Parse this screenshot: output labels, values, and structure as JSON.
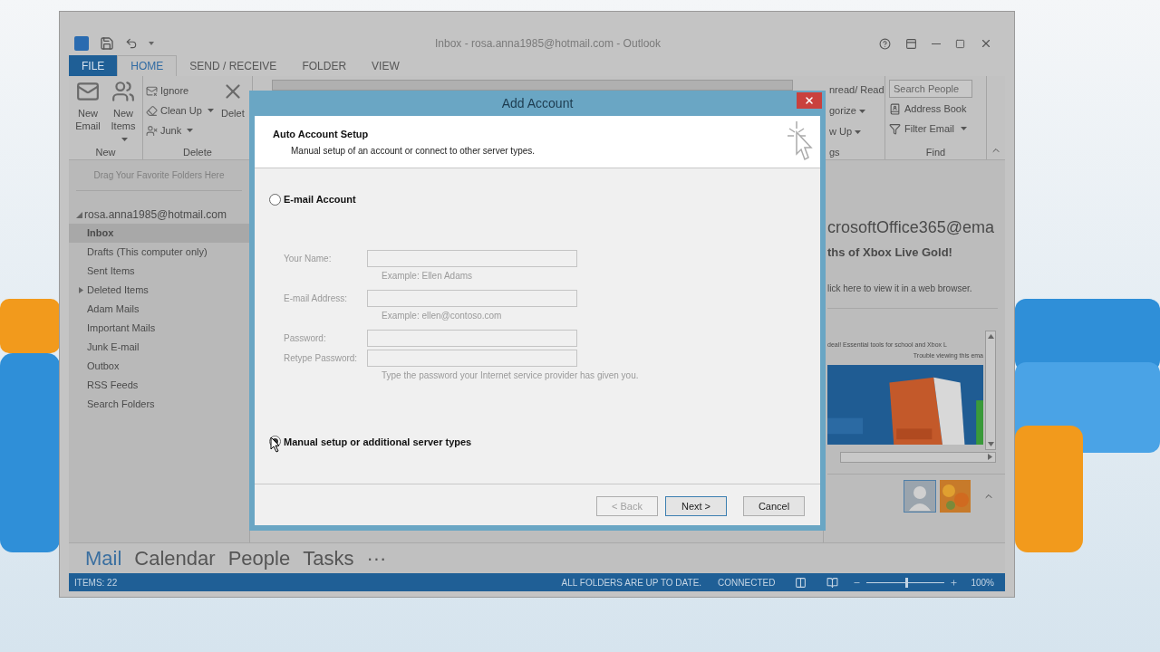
{
  "window": {
    "title": "Inbox - rosa.anna1985@hotmail.com - Outlook"
  },
  "ribbon_tabs": [
    {
      "label": "FILE",
      "kind": "file",
      "selected": false
    },
    {
      "label": "HOME",
      "kind": "tab",
      "selected": true
    },
    {
      "label": "SEND / RECEIVE",
      "kind": "tab",
      "selected": false
    },
    {
      "label": "FOLDER",
      "kind": "tab",
      "selected": false
    },
    {
      "label": "VIEW",
      "kind": "tab",
      "selected": false
    }
  ],
  "ribbon_left": [
    {
      "label": "New",
      "items": [
        {
          "label": "New Email",
          "kind": "large",
          "dropdown": false
        },
        {
          "label": "New Items",
          "kind": "large",
          "dropdown": true
        }
      ]
    },
    {
      "label": "Delete",
      "items": [
        {
          "label": "Ignore",
          "kind": "small",
          "dropdown": false
        },
        {
          "label": "Clean Up",
          "kind": "small",
          "dropdown": true
        },
        {
          "label": "Junk",
          "kind": "small",
          "dropdown": true
        },
        {
          "label": "Delet",
          "kind": "large",
          "dropdown": false
        }
      ]
    }
  ],
  "ribbon_right": {
    "tags": {
      "label": "gs",
      "items": [
        {
          "label": "nread/ Read"
        },
        {
          "label": "gorize",
          "dropdown": true
        },
        {
          "label": "w Up",
          "dropdown": true
        }
      ]
    },
    "find": {
      "label": "Find",
      "search_placeholder": "Search People",
      "items": [
        {
          "label": "Address Book",
          "dropdown": false
        },
        {
          "label": "Filter Email",
          "dropdown": true
        }
      ]
    }
  },
  "folder_pane": {
    "favorites_hint": "Drag Your Favorite Folders Here",
    "account": "rosa.anna1985@hotmail.com",
    "expanded": true,
    "folders": [
      {
        "label": "Inbox",
        "selected": true,
        "has_children": false
      },
      {
        "label": "Drafts (This computer only)",
        "selected": false,
        "has_children": false
      },
      {
        "label": "Sent Items",
        "selected": false,
        "has_children": false
      },
      {
        "label": "Deleted Items",
        "selected": false,
        "has_children": true
      },
      {
        "label": "Adam Mails",
        "selected": false,
        "has_children": false
      },
      {
        "label": "Important Mails",
        "selected": false,
        "has_children": false
      },
      {
        "label": "Junk E-mail",
        "selected": false,
        "has_children": false
      },
      {
        "label": "Outbox",
        "selected": false,
        "has_children": false
      },
      {
        "label": "RSS Feeds",
        "selected": false,
        "has_children": false
      },
      {
        "label": "Search Folders",
        "selected": false,
        "has_children": false
      }
    ]
  },
  "reading_pane": {
    "sender": "crosoftOffice365@ema",
    "subject": "ths of Xbox Live Gold!",
    "notice": "lick here to view it in a web browser.",
    "body_lines": [
      "deal! Essential tools for school and Xbox L",
      "Trouble viewing this ema"
    ]
  },
  "nav": [
    {
      "label": "Mail",
      "selected": true
    },
    {
      "label": "Calendar",
      "selected": false
    },
    {
      "label": "People",
      "selected": false
    },
    {
      "label": "Tasks",
      "selected": false
    },
    {
      "label": "···",
      "selected": false
    }
  ],
  "status_bar": {
    "items": "ITEMS: 22",
    "sync": "ALL FOLDERS ARE UP TO DATE.",
    "connection": "CONNECTED",
    "zoom": {
      "level": 0.5,
      "reading": "100%"
    }
  },
  "dialog": {
    "title": "Add Account",
    "heading": "Auto Account Setup",
    "subheading": "Manual setup of an account or connect to other server types.",
    "options": [
      {
        "label": "E-mail Account",
        "selected": false
      },
      {
        "label": "Manual setup or additional server types",
        "selected": true
      }
    ],
    "form_disabled": true,
    "fields": [
      {
        "label": "Your Name:",
        "hint": "Example: Ellen Adams"
      },
      {
        "label": "E-mail Address:",
        "hint": "Example: ellen@contoso.com"
      },
      {
        "label": "Password:"
      },
      {
        "label": "Retype Password:",
        "hint": "Type the password your Internet service provider has given you."
      }
    ],
    "buttons": [
      {
        "label": "< Back",
        "default": false,
        "disabled": true
      },
      {
        "label": "Next >",
        "default": true,
        "disabled": false
      },
      {
        "label": "Cancel",
        "default": false,
        "disabled": false
      }
    ]
  }
}
